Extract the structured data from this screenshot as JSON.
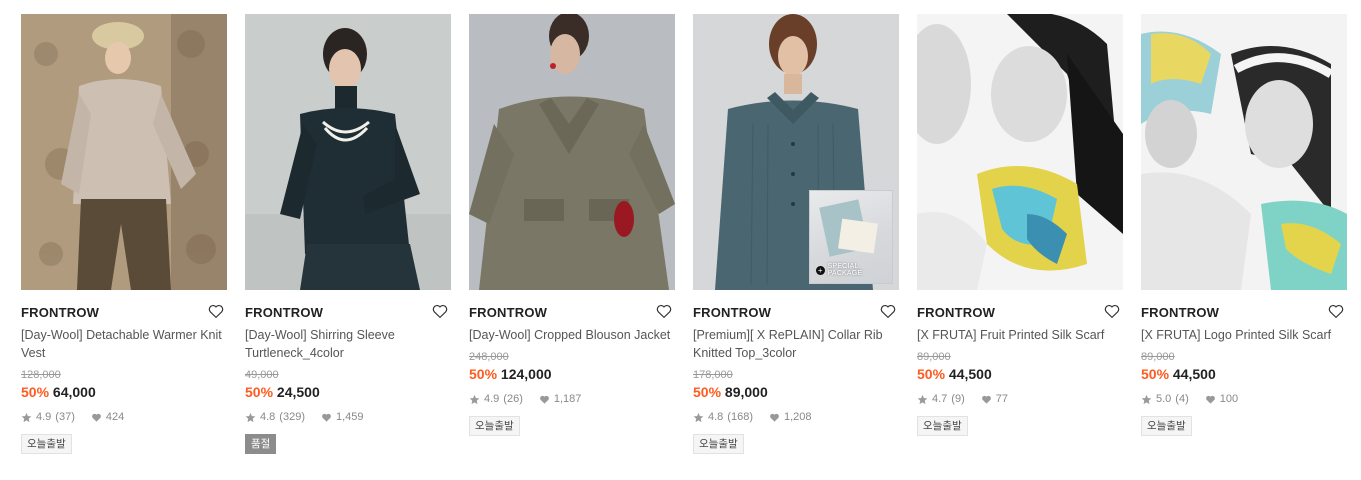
{
  "products": [
    {
      "brand": "FRONTROW",
      "name_line1": "[Day-Wool] Detachable Warmer Knit",
      "name_line2": "Vest",
      "original_price": "128,000",
      "discount": "50%",
      "price": "64,000",
      "rating": "4.9",
      "reviews": "(37)",
      "likes": "424",
      "badge": "오늘출발",
      "badge_type": "normal"
    },
    {
      "brand": "FRONTROW",
      "name_line1": "[Day-Wool] Shirring Sleeve",
      "name_line2": "Turtleneck_4color",
      "original_price": "49,000",
      "discount": "50%",
      "price": "24,500",
      "rating": "4.8",
      "reviews": "(329)",
      "likes": "1,459",
      "badge": "품절",
      "badge_type": "sold-out"
    },
    {
      "brand": "FRONTROW",
      "name_line1": "[Day-Wool] Cropped Blouson Jacket",
      "name_line2": "",
      "original_price": "248,000",
      "discount": "50%",
      "price": "124,000",
      "rating": "4.9",
      "reviews": "(26)",
      "likes": "1,187",
      "badge": "오늘출발",
      "badge_type": "normal"
    },
    {
      "brand": "FRONTROW",
      "name_line1": "[Premium][ X RePLAIN] Collar Rib",
      "name_line2": "Knitted Top_3color",
      "original_price": "178,000",
      "discount": "50%",
      "price": "89,000",
      "rating": "4.8",
      "reviews": "(168)",
      "likes": "1,208",
      "badge": "오늘출발",
      "badge_type": "normal",
      "package_label": "SPECIAL PACKAGE"
    },
    {
      "brand": "FRONTROW",
      "name_line1": "[X FRUTA] Fruit Printed Silk Scarf",
      "name_line2": "",
      "original_price": "89,000",
      "discount": "50%",
      "price": "44,500",
      "rating": "4.7",
      "reviews": "(9)",
      "likes": "77",
      "badge": "오늘출발",
      "badge_type": "normal"
    },
    {
      "brand": "FRONTROW",
      "name_line1": "[X FRUTA] Logo Printed Silk Scarf",
      "name_line2": "",
      "original_price": "89,000",
      "discount": "50%",
      "price": "44,500",
      "rating": "5.0",
      "reviews": "(4)",
      "likes": "100",
      "badge": "오늘출발",
      "badge_type": "normal"
    }
  ],
  "colors": {
    "discount": "#ff5a1f",
    "text": "#222222",
    "muted": "#888888",
    "sold_out_badge": "#8c8c8c"
  },
  "icons": {
    "wishlist": "heart-outline-icon",
    "rating": "star-icon",
    "likes": "heart-filled-icon",
    "package": "plus-circle-icon"
  }
}
